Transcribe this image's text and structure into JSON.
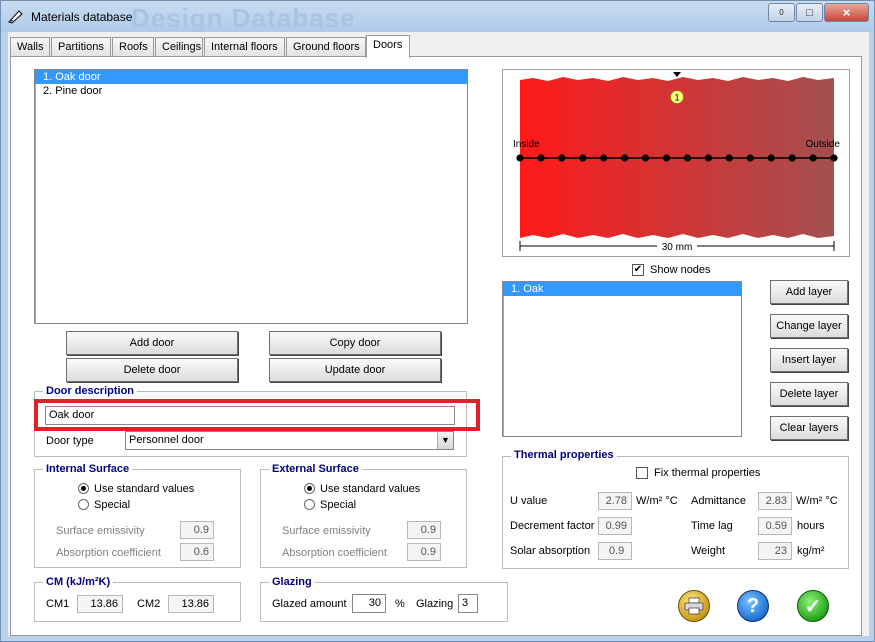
{
  "window": {
    "title": "Materials database",
    "watermark": "Design Database",
    "minimize": "0",
    "restore": "□",
    "close": "×"
  },
  "tabs": [
    {
      "label": "Walls"
    },
    {
      "label": "Partitions"
    },
    {
      "label": "Roofs"
    },
    {
      "label": "Ceilings"
    },
    {
      "label": "Internal floors"
    },
    {
      "label": "Ground floors"
    },
    {
      "label": "Doors",
      "active": true
    }
  ],
  "doors": {
    "items": [
      "1. Oak door",
      "2. Pine door"
    ],
    "selected_index": 0
  },
  "door_buttons": {
    "add": "Add door",
    "copy": "Copy door",
    "delete": "Delete door",
    "update": "Update door"
  },
  "door_description": {
    "title": "Door description",
    "value": "Oak door",
    "type_label": "Door type",
    "type_value": "Personnel door"
  },
  "internal_surface": {
    "title": "Internal Surface",
    "standard": "Use standard values",
    "special": "Special",
    "emissivity_label": "Surface emissivity",
    "emissivity": "0.9",
    "absorption_label": "Absorption coefficient",
    "absorption": "0.6",
    "selected": "standard"
  },
  "external_surface": {
    "title": "External Surface",
    "standard": "Use standard values",
    "special": "Special",
    "emissivity_label": "Surface emissivity",
    "emissivity": "0.9",
    "absorption_label": "Absorption coefficient",
    "absorption": "0.9",
    "selected": "standard"
  },
  "cm": {
    "title": "CM (kJ/m²K)",
    "cm1_label": "CM1",
    "cm1": "13.86",
    "cm2_label": "CM2",
    "cm2": "13.86"
  },
  "glazing": {
    "title": "Glazing",
    "amount_label": "Glazed amount",
    "amount": "30",
    "unit": "%",
    "glazing_label": "Glazing",
    "glazing": "3"
  },
  "diagram": {
    "inside": "Inside",
    "outside": "Outside",
    "thickness": "30 mm",
    "layer_number": "1",
    "node_count": 16,
    "color_inside": "#ff1a1a",
    "color_outside": "#a35050"
  },
  "show_nodes": {
    "label": "Show nodes",
    "checked": true
  },
  "layers": {
    "items": [
      "1. Oak"
    ],
    "selected_index": 0
  },
  "layer_buttons": {
    "add": "Add layer",
    "change": "Change layer",
    "insert": "Insert layer",
    "delete": "Delete layer",
    "clear": "Clear layers"
  },
  "thermal": {
    "title": "Thermal properties",
    "fix_label": "Fix thermal properties",
    "fix_checked": false,
    "u_label": "U value",
    "u": "2.78",
    "u_unit": "W/m² °C",
    "admittance_label": "Admittance",
    "admittance": "2.83",
    "admittance_unit": "W/m² °C",
    "decrement_label": "Decrement factor",
    "decrement": "0.99",
    "timelag_label": "Time lag",
    "timelag": "0.59",
    "timelag_unit": "hours",
    "solar_label": "Solar absorption",
    "solar": "0.9",
    "weight_label": "Weight",
    "weight": "23",
    "weight_unit": "kg/m²"
  },
  "icons": {
    "print": "printer-icon",
    "help": "help-icon",
    "ok": "checkmark-icon",
    "help_glyph": "?",
    "ok_glyph": "✓"
  }
}
